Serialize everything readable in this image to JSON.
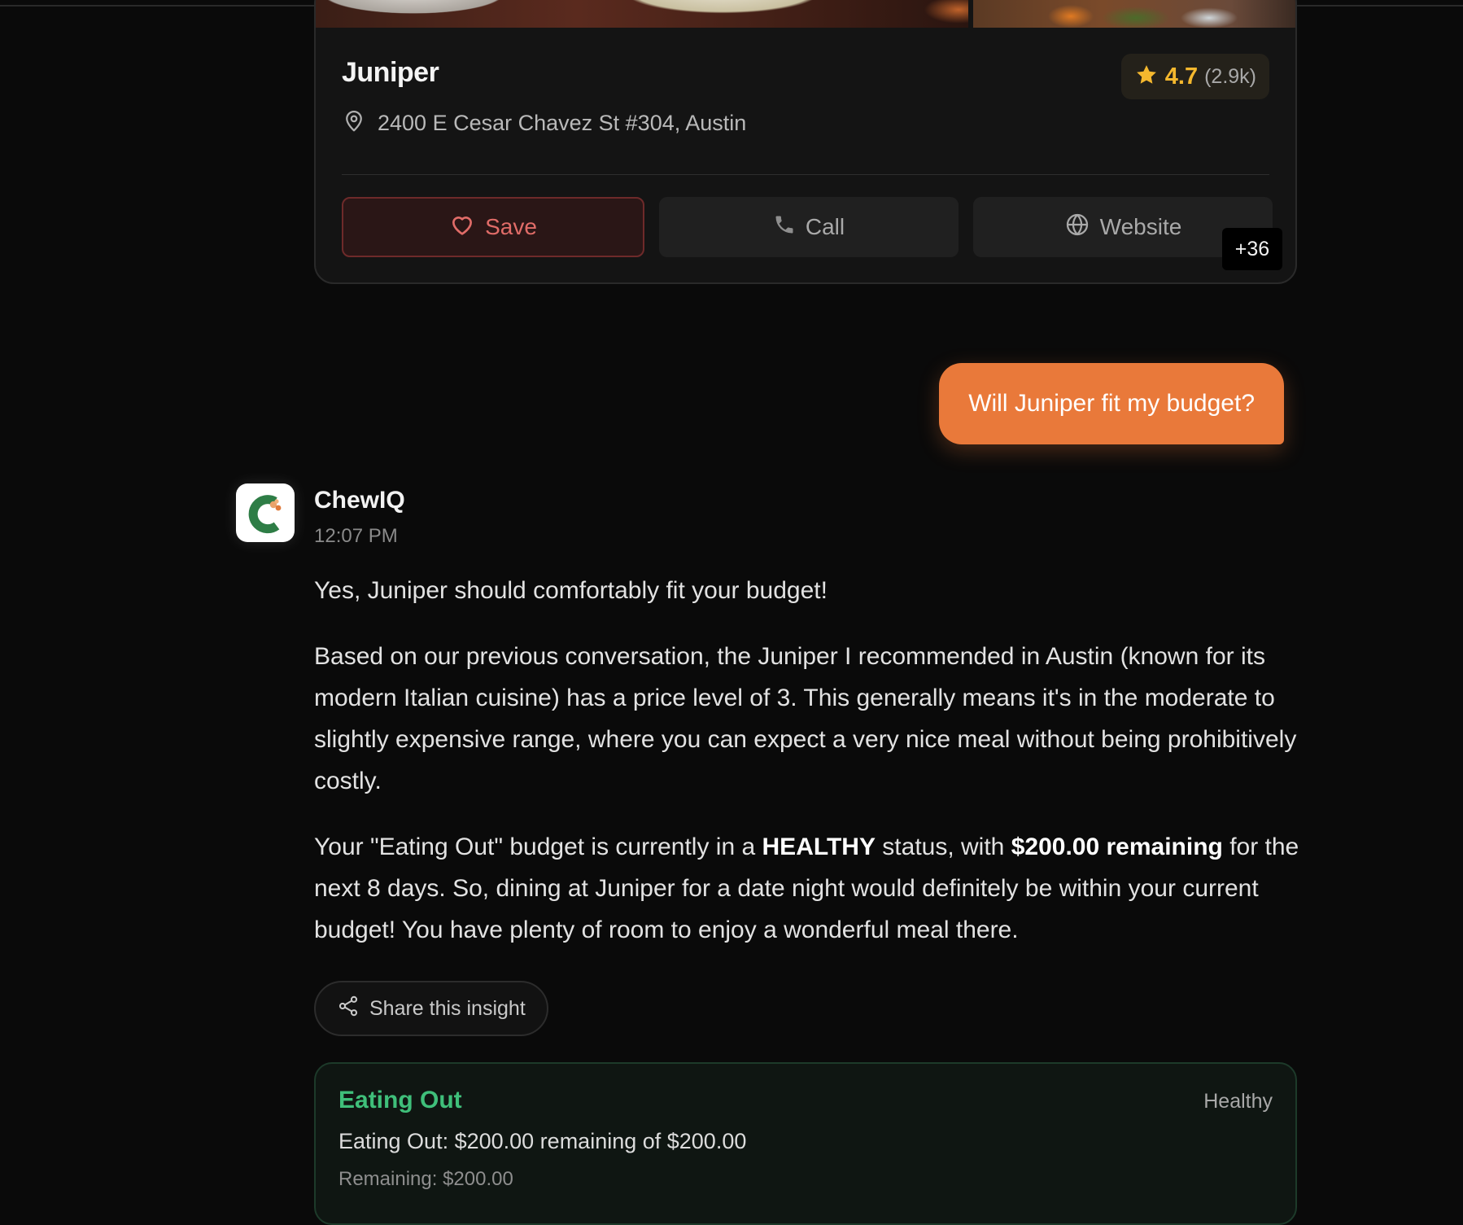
{
  "restaurant": {
    "name": "Juniper",
    "rating": "4.7",
    "rating_count": "(2.9k)",
    "address": "2400 E Cesar Chavez St #304, Austin",
    "save_label": "Save",
    "call_label": "Call",
    "website_label": "Website",
    "more_count": "+36"
  },
  "user_message": "Will Juniper fit my budget?",
  "assistant": {
    "name": "ChewIQ",
    "time": "12:07 PM",
    "p1": "Yes, Juniper should comfortably fit your budget!",
    "p2": "Based on our previous conversation, the Juniper I recommended in Austin (known for its modern Italian cuisine) has a price level of 3. This generally means it's in the moderate to slightly expensive range, where you can expect a very nice meal without being prohibitively costly.",
    "p3_a": "Your \"Eating Out\" budget is currently in a ",
    "p3_b": "HEALTHY",
    "p3_c": " status, with ",
    "p3_d": "$200.00 remaining",
    "p3_e": " for the next 8 days. So, dining at Juniper for a date night would definitely be within your current budget! You have plenty of room to enjoy a wonderful meal there.",
    "share_label": "Share this insight"
  },
  "budget": {
    "title": "Eating Out",
    "status": "Healthy",
    "summary": "Eating Out: $200.00 remaining of $200.00",
    "remaining": "Remaining: $200.00"
  },
  "colors": {
    "accent": "#e9793a",
    "star": "#f5b82e",
    "save": "#e06c68",
    "budget_green": "#3fbf7a"
  }
}
